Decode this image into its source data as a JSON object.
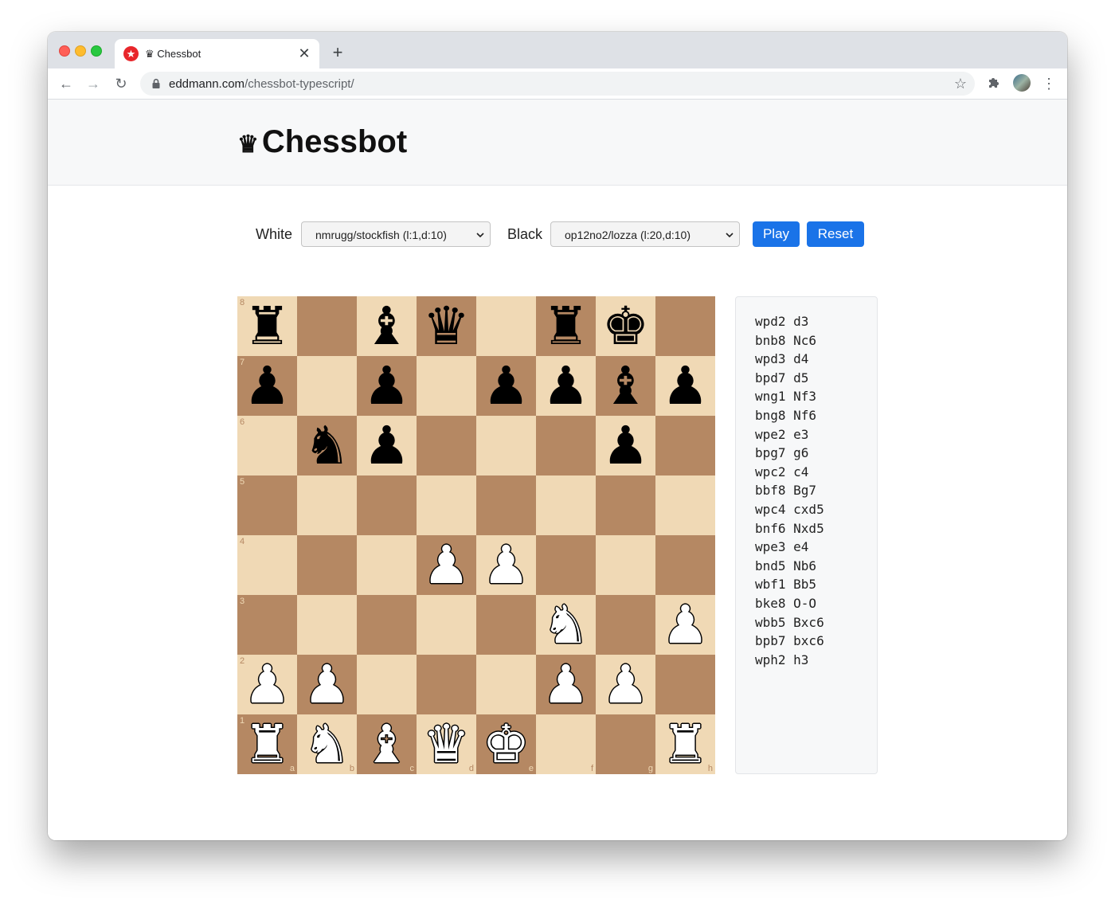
{
  "browser": {
    "tab_title": "♛ Chessbot",
    "tab_close": "✕",
    "new_tab": "+",
    "url_host": "eddmann.com",
    "url_path": "/chessbot-typescript/",
    "back": "←",
    "forward": "→",
    "reload": "↻",
    "star": "☆",
    "menu": "⋮"
  },
  "header": {
    "crown": "♛",
    "title": "Chessbot"
  },
  "controls": {
    "white_label": "White",
    "white_engine": "nmrugg/stockfish (l:1,d:10)",
    "black_label": "Black",
    "black_engine": "op12no2/lozza (l:20,d:10)",
    "play_label": "Play",
    "reset_label": "Reset"
  },
  "board": {
    "light_color": "#f0d9b5",
    "dark_color": "#b58863",
    "files": [
      "a",
      "b",
      "c",
      "d",
      "e",
      "f",
      "g",
      "h"
    ],
    "ranks": [
      "8",
      "7",
      "6",
      "5",
      "4",
      "3",
      "2",
      "1"
    ],
    "position": [
      [
        "r",
        "",
        "b",
        "q",
        "",
        "r",
        "k",
        ""
      ],
      [
        "p",
        "",
        "p",
        "",
        "p",
        "p",
        "b",
        "p"
      ],
      [
        "",
        "n",
        "p",
        "",
        "",
        "",
        "p",
        ""
      ],
      [
        "",
        "",
        "",
        "",
        "",
        "",
        "",
        ""
      ],
      [
        "",
        "",
        "",
        "P",
        "P",
        "",
        "",
        ""
      ],
      [
        "",
        "",
        "",
        "",
        "",
        "N",
        "",
        "P"
      ],
      [
        "P",
        "P",
        "",
        "",
        "",
        "P",
        "P",
        ""
      ],
      [
        "R",
        "N",
        "B",
        "Q",
        "K",
        "",
        "",
        "R"
      ]
    ]
  },
  "moves": [
    "wpd2 d3",
    "bnb8 Nc6",
    "wpd3 d4",
    "bpd7 d5",
    "wng1 Nf3",
    "bng8 Nf6",
    "wpe2 e3",
    "bpg7 g6",
    "wpc2 c4",
    "bbf8 Bg7",
    "wpc4 cxd5",
    "bnf6 Nxd5",
    "wpe3 e4",
    "bnd5 Nb6",
    "wbf1 Bb5",
    "bke8 O-O",
    "wbb5 Bxc6",
    "bpb7 bxc6",
    "wph2 h3"
  ],
  "accent_color": "#1a73e8"
}
